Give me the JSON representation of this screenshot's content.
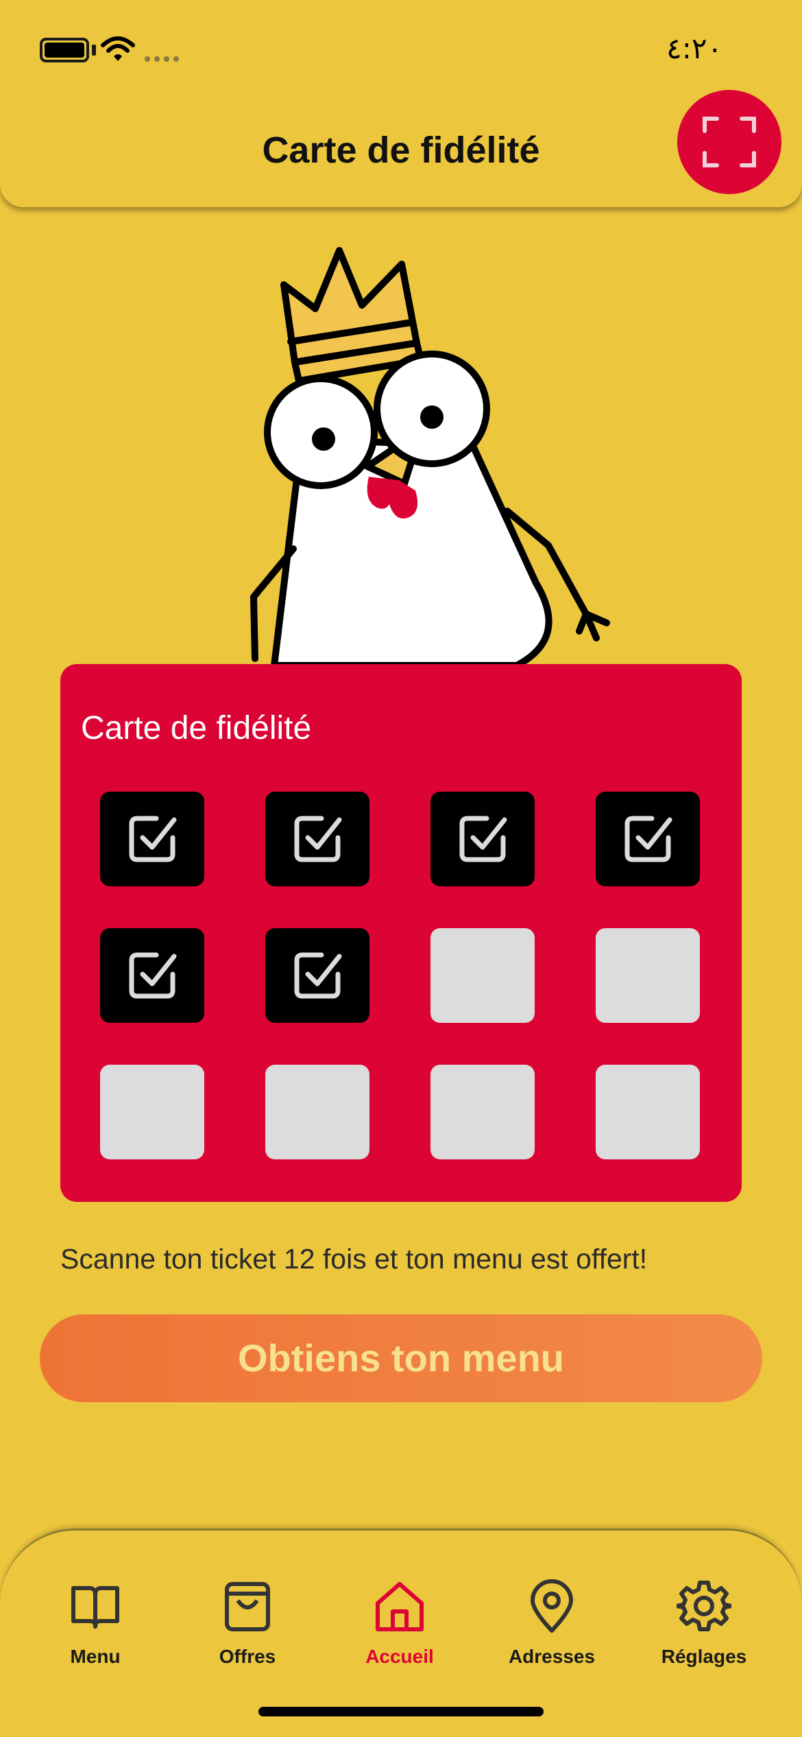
{
  "status_bar": {
    "time": "٤:٢٠"
  },
  "header": {
    "title": "Carte de fidélité",
    "scan_icon": "scan-frame-icon"
  },
  "card": {
    "title": "Carte de fidélité",
    "stamps_total": 12,
    "stamps_collected": 6,
    "stamps": [
      true,
      true,
      true,
      true,
      true,
      true,
      false,
      false,
      false,
      false,
      false,
      false
    ]
  },
  "instructions": "Scanne ton ticket 12 fois et ton menu est offert!",
  "cta": {
    "label": "Obtiens ton menu"
  },
  "tabs": [
    {
      "label": "Menu",
      "icon": "book-icon",
      "active": false
    },
    {
      "label": "Offres",
      "icon": "bag-icon",
      "active": false
    },
    {
      "label": "Accueil",
      "icon": "home-icon",
      "active": true
    },
    {
      "label": "Adresses",
      "icon": "location-pin-icon",
      "active": false
    },
    {
      "label": "Réglages",
      "icon": "gear-icon",
      "active": false
    }
  ],
  "colors": {
    "background": "#ECC63D",
    "card": "#DC0435",
    "accent_active": "#DC0435",
    "cta_gradient_start": "#EE7436",
    "cta_gradient_end": "#F28A48",
    "cta_text": "#F7E08E"
  }
}
